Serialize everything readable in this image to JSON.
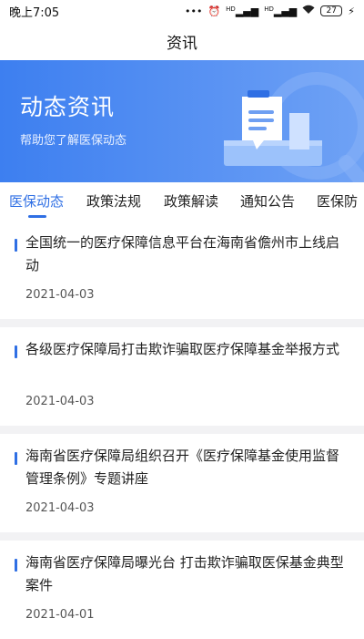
{
  "status_bar": {
    "time": "晚上7:05",
    "network_labels": [
      "HD",
      "HD"
    ],
    "battery": "27"
  },
  "header": {
    "title": "资讯"
  },
  "banner": {
    "title": "动态资讯",
    "subtitle": "帮助您了解医保动态"
  },
  "tabs": [
    {
      "label": "医保动态",
      "active": true
    },
    {
      "label": "政策法规",
      "active": false
    },
    {
      "label": "政策解读",
      "active": false
    },
    {
      "label": "通知公告",
      "active": false
    },
    {
      "label": "医保防",
      "active": false
    }
  ],
  "news": [
    {
      "title": "全国统一的医疗保障信息平台在海南省儋州市上线启动",
      "date": "2021-04-03"
    },
    {
      "title": "各级医疗保障局打击欺诈骗取医疗保障基金举报方式",
      "date": "2021-04-03"
    },
    {
      "title": "海南省医疗保障局组织召开《医疗保障基金使用监督管理条例》专题讲座",
      "date": "2021-04-03"
    },
    {
      "title": "海南省医疗保障局曝光台  打击欺诈骗取医保基金典型案件",
      "date": "2021-04-01"
    }
  ],
  "colors": {
    "accent": "#2f6fe4",
    "banner": "#4a89f2"
  }
}
